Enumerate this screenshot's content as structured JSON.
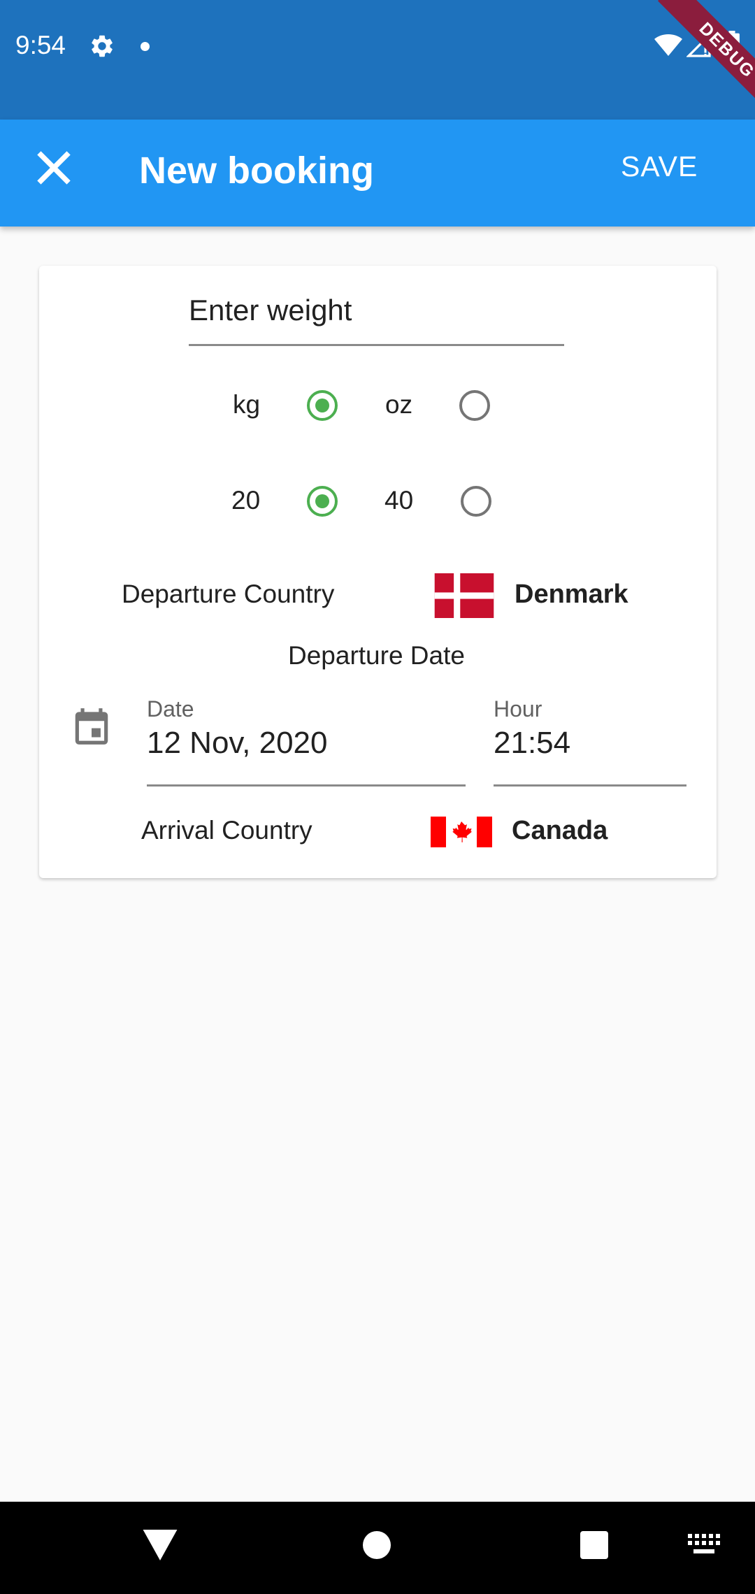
{
  "status_bar": {
    "time": "9:54",
    "debug_label": "DEBUG",
    "icons": [
      "gear-icon",
      "dot-icon",
      "wifi-icon",
      "signal-icon",
      "battery-icon"
    ]
  },
  "app_bar": {
    "title": "New booking",
    "save_label": "SAVE",
    "close_icon": "close-icon",
    "color": "#2196f3"
  },
  "form": {
    "weight_placeholder": "Enter weight",
    "unit_options": [
      {
        "label": "kg",
        "selected": true
      },
      {
        "label": "oz",
        "selected": false
      }
    ],
    "size_options": [
      {
        "label": "20",
        "selected": true
      },
      {
        "label": "40",
        "selected": false
      }
    ],
    "departure_country_label": "Departure Country",
    "departure_country": "Denmark",
    "departure_date_label": "Departure Date",
    "date_label": "Date",
    "date_value": "12 Nov, 2020",
    "hour_label": "Hour",
    "hour_value": "21:54",
    "arrival_country_label": "Arrival Country",
    "arrival_country": "Canada",
    "accent_color": "#4caf50"
  },
  "nav_bar": {
    "icons": [
      "back-icon",
      "home-icon",
      "recents-icon",
      "keyboard-icon"
    ]
  }
}
